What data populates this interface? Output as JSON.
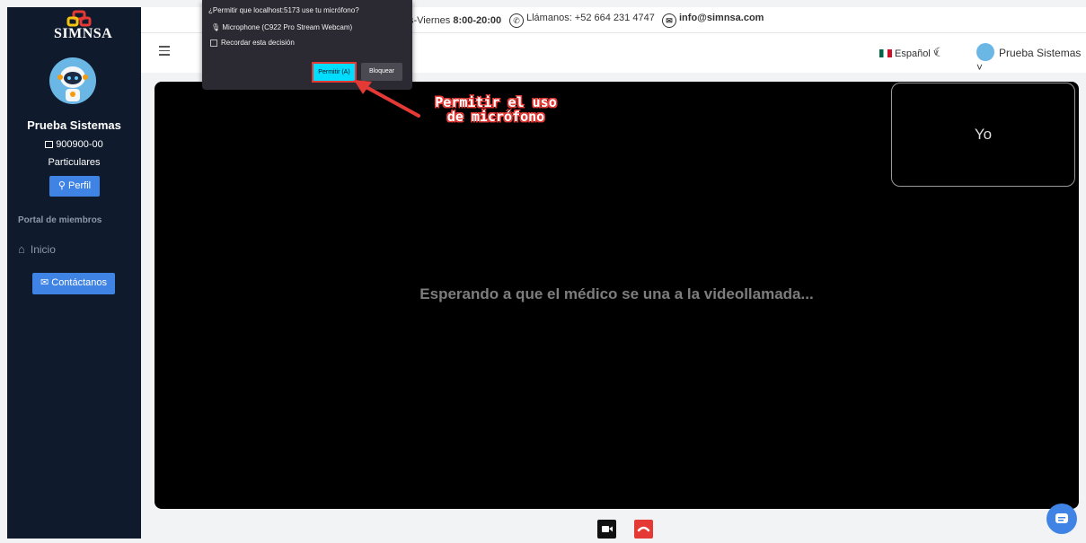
{
  "sidebar": {
    "logo_text": "SIMNSA",
    "user_name": "Prueba Sistemas",
    "user_id": "900900-00",
    "user_plan": "Particulares",
    "profile_label": "Perfil",
    "section_title": "Portal de miembros",
    "nav_home": "Inicio",
    "contact_label": "Contáctanos"
  },
  "topbar": {
    "hours_prefix": "s-Viernes",
    "hours_value": "8:00-20:00",
    "phone": "Llámanos: +52 664 231 4747",
    "email": "info@simnsa.com"
  },
  "header": {
    "language": "Español",
    "user_menu": "Prueba Sistemas"
  },
  "video": {
    "self_label": "Yo",
    "waiting_message": "Esperando a que el médico se una a la videollamada..."
  },
  "permission_dialog": {
    "question": "¿Permitir que localhost:5173 use tu micrófono?",
    "device": "Microphone (C922 Pro Stream Webcam)",
    "remember": "Recordar esta decisión",
    "allow": "Permitir (A)",
    "block": "Bloquear"
  },
  "annotation": {
    "line1": "Permitir el uso",
    "line2": "de micrófono"
  },
  "colors": {
    "sidebar_bg": "#0f1b2d",
    "primary": "#3f84e5",
    "danger": "#e53935",
    "allow_button": "#00ddff"
  }
}
